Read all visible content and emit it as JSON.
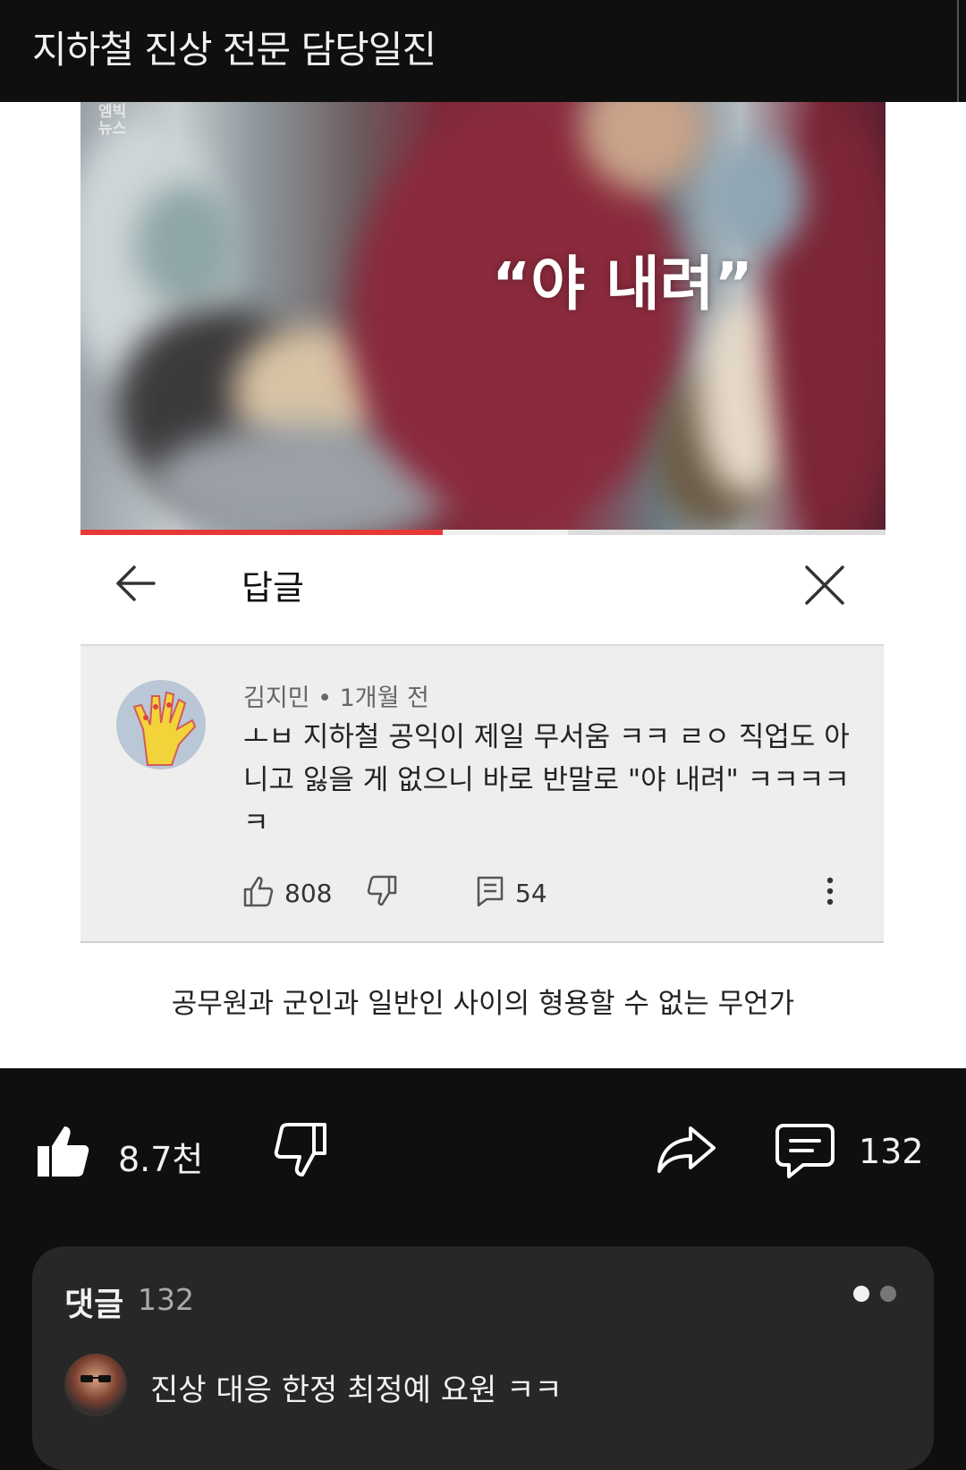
{
  "header": {
    "title": "지하철 진상 전문 담당일진"
  },
  "video": {
    "watermark_line1": "엠빅",
    "watermark_line2": "뉴스",
    "caption": "“야 내려”",
    "progress_percent": 45
  },
  "reply_panel": {
    "title": "답글",
    "comment": {
      "author_meta": "김지민 • 1개월 전",
      "text": "ㅗㅂ 지하철 공익이 제일 무서움 ㅋㅋ ㄹㅇ 직업도 아니고 잃을 게 없으니 바로 반말로 \"야 내려\" ㅋㅋㅋㅋㅋ",
      "likes": "808",
      "replies": "54"
    }
  },
  "post_caption": "공무원과 군인과 일반인 사이의 형용할 수 없는 무언가",
  "actions": {
    "likes": "8.7천",
    "comments": "132"
  },
  "comments_section": {
    "heading": "댓글",
    "count": "132",
    "top_comment": "진상 대응 한정 최정예 요원 ㅋㅋ"
  },
  "colors": {
    "accent_red": "#e53935",
    "bg_dark": "#0f0f0f",
    "panel": "#272727"
  }
}
